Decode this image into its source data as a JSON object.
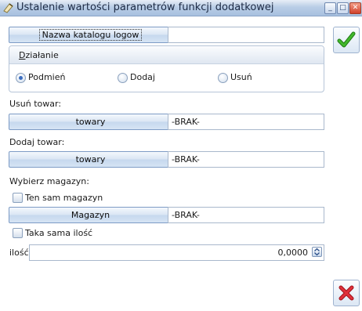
{
  "window": {
    "title": "Ustalenie wartości parametrów funkcji dodatkowej",
    "min_glyph": "_",
    "max_glyph": "□",
    "close_glyph": "✕"
  },
  "catalog": {
    "button_label": "Nazwa katalogu logow",
    "value": ""
  },
  "action_group": {
    "title_prefix": "D",
    "title_rest": "ziałanie",
    "options": [
      {
        "label": "Podmień",
        "selected": true
      },
      {
        "label": "Dodaj",
        "selected": false
      },
      {
        "label": "Usuń",
        "selected": false
      }
    ]
  },
  "remove_item": {
    "label": "Usuń towar:",
    "button_label": "towary",
    "value": "-BRAK-"
  },
  "add_item": {
    "label": "Dodaj towar:",
    "button_label": "towary",
    "value": "-BRAK-"
  },
  "warehouse": {
    "label": "Wybierz magazyn:",
    "same_warehouse_label": "Ten sam magazyn",
    "same_warehouse_checked": false,
    "button_label": "Magazyn",
    "value": "-BRAK-"
  },
  "quantity": {
    "same_quantity_label": "Taka sama ilość",
    "same_quantity_checked": false,
    "label": "ilość",
    "value": "0,0000"
  },
  "icons": {
    "ok": "check-icon",
    "cancel": "cross-icon"
  },
  "colors": {
    "ok_green": "#2e9a1c",
    "cancel_red": "#d0202a",
    "radio_dot": "#3c6ec0"
  }
}
